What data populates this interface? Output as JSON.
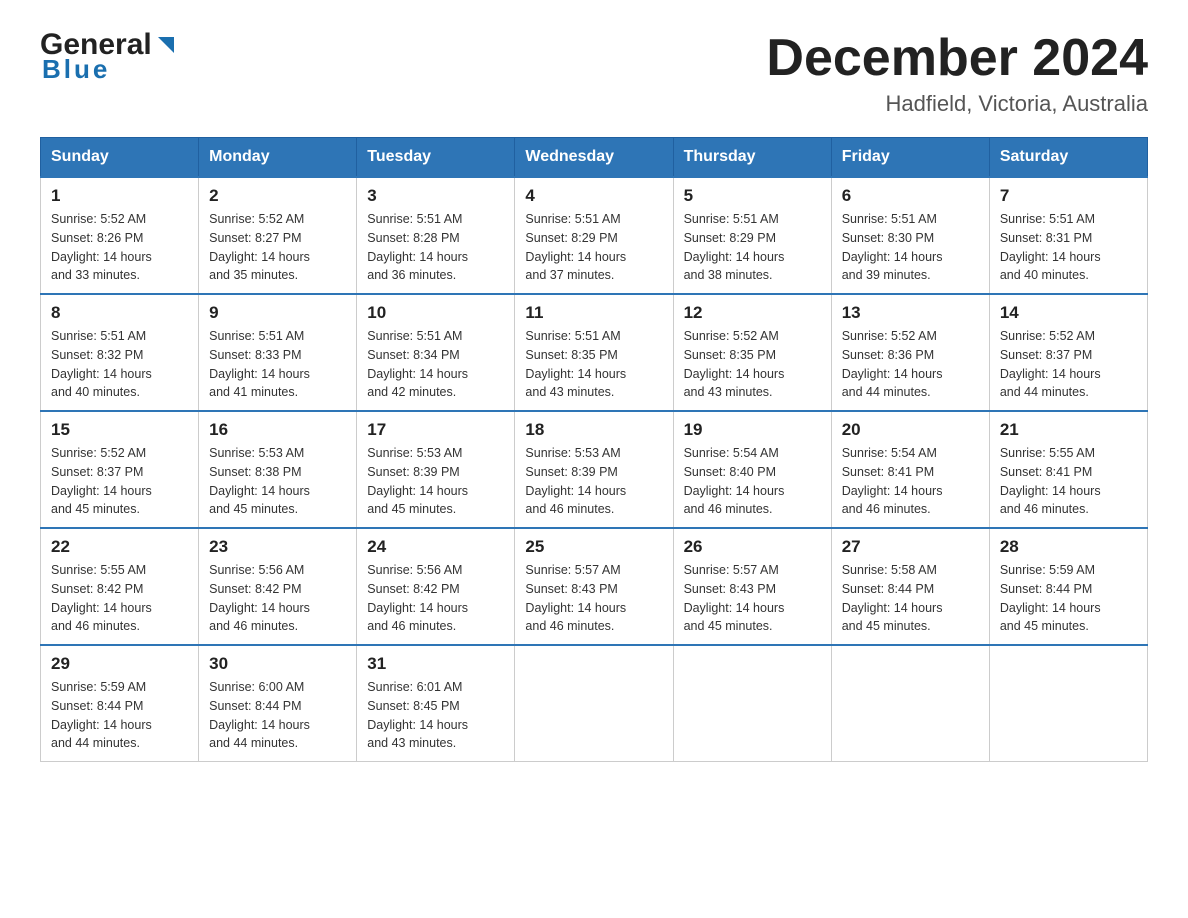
{
  "logo": {
    "general": "General",
    "blue": "Blue",
    "arrow_unicode": "▶"
  },
  "title": "December 2024",
  "subtitle": "Hadfield, Victoria, Australia",
  "headers": [
    "Sunday",
    "Monday",
    "Tuesday",
    "Wednesday",
    "Thursday",
    "Friday",
    "Saturday"
  ],
  "weeks": [
    [
      {
        "day": "1",
        "sunrise": "5:52 AM",
        "sunset": "8:26 PM",
        "daylight": "14 hours and 33 minutes."
      },
      {
        "day": "2",
        "sunrise": "5:52 AM",
        "sunset": "8:27 PM",
        "daylight": "14 hours and 35 minutes."
      },
      {
        "day": "3",
        "sunrise": "5:51 AM",
        "sunset": "8:28 PM",
        "daylight": "14 hours and 36 minutes."
      },
      {
        "day": "4",
        "sunrise": "5:51 AM",
        "sunset": "8:29 PM",
        "daylight": "14 hours and 37 minutes."
      },
      {
        "day": "5",
        "sunrise": "5:51 AM",
        "sunset": "8:29 PM",
        "daylight": "14 hours and 38 minutes."
      },
      {
        "day": "6",
        "sunrise": "5:51 AM",
        "sunset": "8:30 PM",
        "daylight": "14 hours and 39 minutes."
      },
      {
        "day": "7",
        "sunrise": "5:51 AM",
        "sunset": "8:31 PM",
        "daylight": "14 hours and 40 minutes."
      }
    ],
    [
      {
        "day": "8",
        "sunrise": "5:51 AM",
        "sunset": "8:32 PM",
        "daylight": "14 hours and 40 minutes."
      },
      {
        "day": "9",
        "sunrise": "5:51 AM",
        "sunset": "8:33 PM",
        "daylight": "14 hours and 41 minutes."
      },
      {
        "day": "10",
        "sunrise": "5:51 AM",
        "sunset": "8:34 PM",
        "daylight": "14 hours and 42 minutes."
      },
      {
        "day": "11",
        "sunrise": "5:51 AM",
        "sunset": "8:35 PM",
        "daylight": "14 hours and 43 minutes."
      },
      {
        "day": "12",
        "sunrise": "5:52 AM",
        "sunset": "8:35 PM",
        "daylight": "14 hours and 43 minutes."
      },
      {
        "day": "13",
        "sunrise": "5:52 AM",
        "sunset": "8:36 PM",
        "daylight": "14 hours and 44 minutes."
      },
      {
        "day": "14",
        "sunrise": "5:52 AM",
        "sunset": "8:37 PM",
        "daylight": "14 hours and 44 minutes."
      }
    ],
    [
      {
        "day": "15",
        "sunrise": "5:52 AM",
        "sunset": "8:37 PM",
        "daylight": "14 hours and 45 minutes."
      },
      {
        "day": "16",
        "sunrise": "5:53 AM",
        "sunset": "8:38 PM",
        "daylight": "14 hours and 45 minutes."
      },
      {
        "day": "17",
        "sunrise": "5:53 AM",
        "sunset": "8:39 PM",
        "daylight": "14 hours and 45 minutes."
      },
      {
        "day": "18",
        "sunrise": "5:53 AM",
        "sunset": "8:39 PM",
        "daylight": "14 hours and 46 minutes."
      },
      {
        "day": "19",
        "sunrise": "5:54 AM",
        "sunset": "8:40 PM",
        "daylight": "14 hours and 46 minutes."
      },
      {
        "day": "20",
        "sunrise": "5:54 AM",
        "sunset": "8:41 PM",
        "daylight": "14 hours and 46 minutes."
      },
      {
        "day": "21",
        "sunrise": "5:55 AM",
        "sunset": "8:41 PM",
        "daylight": "14 hours and 46 minutes."
      }
    ],
    [
      {
        "day": "22",
        "sunrise": "5:55 AM",
        "sunset": "8:42 PM",
        "daylight": "14 hours and 46 minutes."
      },
      {
        "day": "23",
        "sunrise": "5:56 AM",
        "sunset": "8:42 PM",
        "daylight": "14 hours and 46 minutes."
      },
      {
        "day": "24",
        "sunrise": "5:56 AM",
        "sunset": "8:42 PM",
        "daylight": "14 hours and 46 minutes."
      },
      {
        "day": "25",
        "sunrise": "5:57 AM",
        "sunset": "8:43 PM",
        "daylight": "14 hours and 46 minutes."
      },
      {
        "day": "26",
        "sunrise": "5:57 AM",
        "sunset": "8:43 PM",
        "daylight": "14 hours and 45 minutes."
      },
      {
        "day": "27",
        "sunrise": "5:58 AM",
        "sunset": "8:44 PM",
        "daylight": "14 hours and 45 minutes."
      },
      {
        "day": "28",
        "sunrise": "5:59 AM",
        "sunset": "8:44 PM",
        "daylight": "14 hours and 45 minutes."
      }
    ],
    [
      {
        "day": "29",
        "sunrise": "5:59 AM",
        "sunset": "8:44 PM",
        "daylight": "14 hours and 44 minutes."
      },
      {
        "day": "30",
        "sunrise": "6:00 AM",
        "sunset": "8:44 PM",
        "daylight": "14 hours and 44 minutes."
      },
      {
        "day": "31",
        "sunrise": "6:01 AM",
        "sunset": "8:45 PM",
        "daylight": "14 hours and 43 minutes."
      },
      null,
      null,
      null,
      null
    ]
  ],
  "sunrise_label": "Sunrise:",
  "sunset_label": "Sunset:",
  "daylight_label": "Daylight:"
}
